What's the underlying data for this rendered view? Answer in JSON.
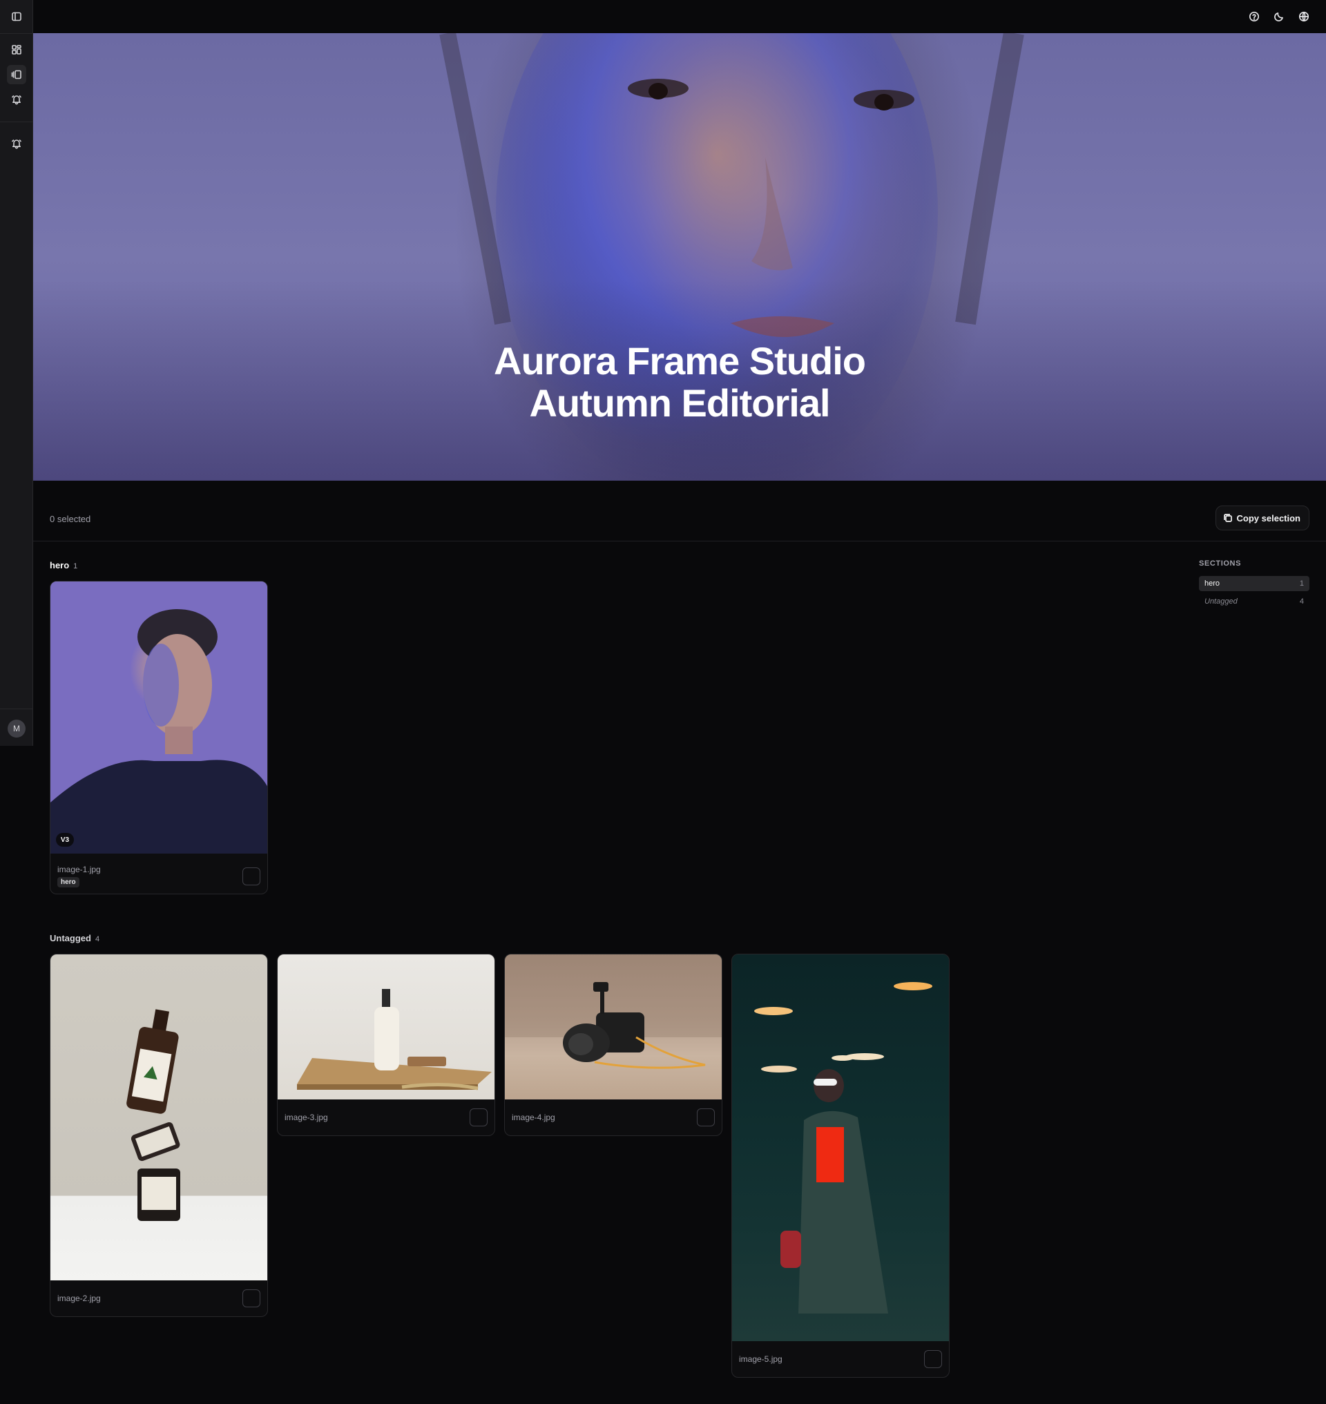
{
  "hero": {
    "title_line1": "Aurora Frame Studio",
    "title_line2": "Autumn Editorial"
  },
  "toolbar": {
    "selected_text": "0 selected",
    "copy_label": "Copy selection"
  },
  "sections": [
    {
      "name": "hero",
      "count": "1",
      "cards": [
        {
          "file": "image-1.jpg",
          "tag": "hero",
          "version": "V3"
        }
      ]
    },
    {
      "name": "Untagged",
      "count": "4",
      "cards": [
        {
          "file": "image-2.jpg"
        },
        {
          "file": "image-3.jpg"
        },
        {
          "file": "image-4.jpg"
        },
        {
          "file": "image-5.jpg"
        }
      ]
    }
  ],
  "sections_panel": {
    "title": "SECTIONS",
    "items": [
      {
        "label": "hero",
        "count": "1"
      },
      {
        "label": "Untagged",
        "count": "4"
      }
    ]
  },
  "user": {
    "initial": "M"
  },
  "icons": {
    "rail": [
      "sidebar-toggle-icon",
      "dashboard-icon",
      "gallery-icon",
      "bell-icon",
      "bell-icon"
    ],
    "top": [
      "help-icon",
      "moon-icon",
      "globe-icon"
    ]
  },
  "colors": {
    "background": "#09090b",
    "surface": "#18181b",
    "border": "#27272a",
    "text": "#fafafa"
  }
}
